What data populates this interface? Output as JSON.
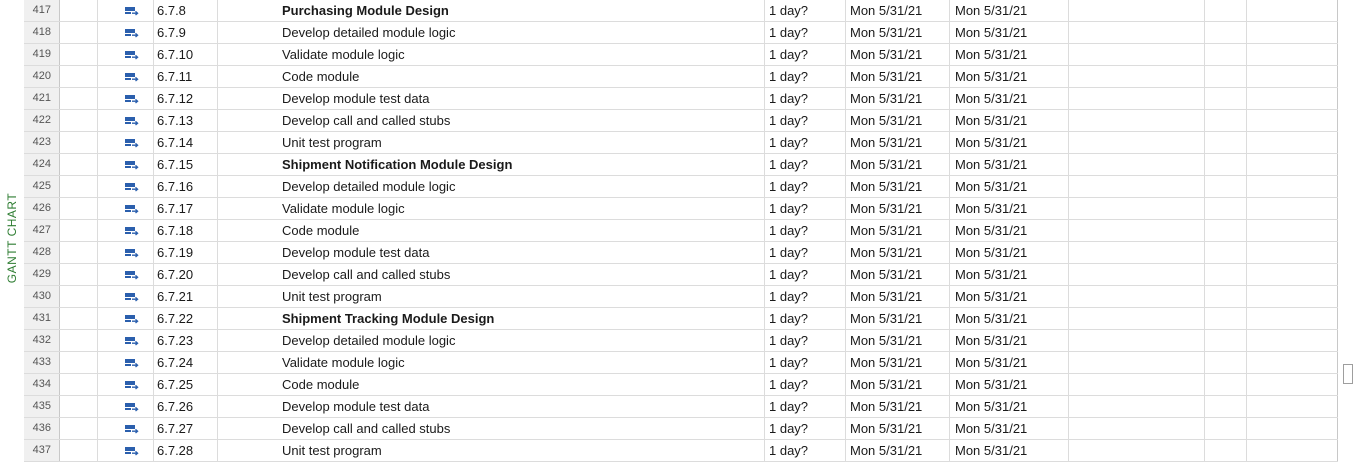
{
  "view": {
    "side_label": "GANTT CHART"
  },
  "colors": {
    "side_label": "#2e7d32",
    "task_mode_icon": "#2b5fad"
  },
  "task_mode_icon": "auto-scheduled-task-icon",
  "rows": [
    {
      "id": "417",
      "wbs": "6.7.8",
      "name": "Purchasing Module Design",
      "summary": true,
      "duration": "1 day?",
      "start": "Mon 5/31/21",
      "finish": "Mon 5/31/21"
    },
    {
      "id": "418",
      "wbs": "6.7.9",
      "name": "Develop detailed module logic",
      "summary": false,
      "duration": "1 day?",
      "start": "Mon 5/31/21",
      "finish": "Mon 5/31/21"
    },
    {
      "id": "419",
      "wbs": "6.7.10",
      "name": "Validate module logic",
      "summary": false,
      "duration": "1 day?",
      "start": "Mon 5/31/21",
      "finish": "Mon 5/31/21"
    },
    {
      "id": "420",
      "wbs": "6.7.11",
      "name": "Code module",
      "summary": false,
      "duration": "1 day?",
      "start": "Mon 5/31/21",
      "finish": "Mon 5/31/21"
    },
    {
      "id": "421",
      "wbs": "6.7.12",
      "name": "Develop module test data",
      "summary": false,
      "duration": "1 day?",
      "start": "Mon 5/31/21",
      "finish": "Mon 5/31/21"
    },
    {
      "id": "422",
      "wbs": "6.7.13",
      "name": "Develop call and called stubs",
      "summary": false,
      "duration": "1 day?",
      "start": "Mon 5/31/21",
      "finish": "Mon 5/31/21"
    },
    {
      "id": "423",
      "wbs": "6.7.14",
      "name": "Unit test program",
      "summary": false,
      "duration": "1 day?",
      "start": "Mon 5/31/21",
      "finish": "Mon 5/31/21"
    },
    {
      "id": "424",
      "wbs": "6.7.15",
      "name": "Shipment Notification Module Design",
      "summary": true,
      "duration": "1 day?",
      "start": "Mon 5/31/21",
      "finish": "Mon 5/31/21"
    },
    {
      "id": "425",
      "wbs": "6.7.16",
      "name": "Develop detailed module logic",
      "summary": false,
      "duration": "1 day?",
      "start": "Mon 5/31/21",
      "finish": "Mon 5/31/21"
    },
    {
      "id": "426",
      "wbs": "6.7.17",
      "name": "Validate module logic",
      "summary": false,
      "duration": "1 day?",
      "start": "Mon 5/31/21",
      "finish": "Mon 5/31/21"
    },
    {
      "id": "427",
      "wbs": "6.7.18",
      "name": "Code module",
      "summary": false,
      "duration": "1 day?",
      "start": "Mon 5/31/21",
      "finish": "Mon 5/31/21"
    },
    {
      "id": "428",
      "wbs": "6.7.19",
      "name": "Develop module test data",
      "summary": false,
      "duration": "1 day?",
      "start": "Mon 5/31/21",
      "finish": "Mon 5/31/21"
    },
    {
      "id": "429",
      "wbs": "6.7.20",
      "name": "Develop call and called stubs",
      "summary": false,
      "duration": "1 day?",
      "start": "Mon 5/31/21",
      "finish": "Mon 5/31/21"
    },
    {
      "id": "430",
      "wbs": "6.7.21",
      "name": "Unit test program",
      "summary": false,
      "duration": "1 day?",
      "start": "Mon 5/31/21",
      "finish": "Mon 5/31/21"
    },
    {
      "id": "431",
      "wbs": "6.7.22",
      "name": "Shipment Tracking Module Design",
      "summary": true,
      "duration": "1 day?",
      "start": "Mon 5/31/21",
      "finish": "Mon 5/31/21"
    },
    {
      "id": "432",
      "wbs": "6.7.23",
      "name": "Develop detailed module logic",
      "summary": false,
      "duration": "1 day?",
      "start": "Mon 5/31/21",
      "finish": "Mon 5/31/21"
    },
    {
      "id": "433",
      "wbs": "6.7.24",
      "name": "Validate module logic",
      "summary": false,
      "duration": "1 day?",
      "start": "Mon 5/31/21",
      "finish": "Mon 5/31/21"
    },
    {
      "id": "434",
      "wbs": "6.7.25",
      "name": "Code module",
      "summary": false,
      "duration": "1 day?",
      "start": "Mon 5/31/21",
      "finish": "Mon 5/31/21"
    },
    {
      "id": "435",
      "wbs": "6.7.26",
      "name": "Develop module test data",
      "summary": false,
      "duration": "1 day?",
      "start": "Mon 5/31/21",
      "finish": "Mon 5/31/21"
    },
    {
      "id": "436",
      "wbs": "6.7.27",
      "name": "Develop call and called stubs",
      "summary": false,
      "duration": "1 day?",
      "start": "Mon 5/31/21",
      "finish": "Mon 5/31/21"
    },
    {
      "id": "437",
      "wbs": "6.7.28",
      "name": "Unit test program",
      "summary": false,
      "duration": "1 day?",
      "start": "Mon 5/31/21",
      "finish": "Mon 5/31/21"
    }
  ]
}
